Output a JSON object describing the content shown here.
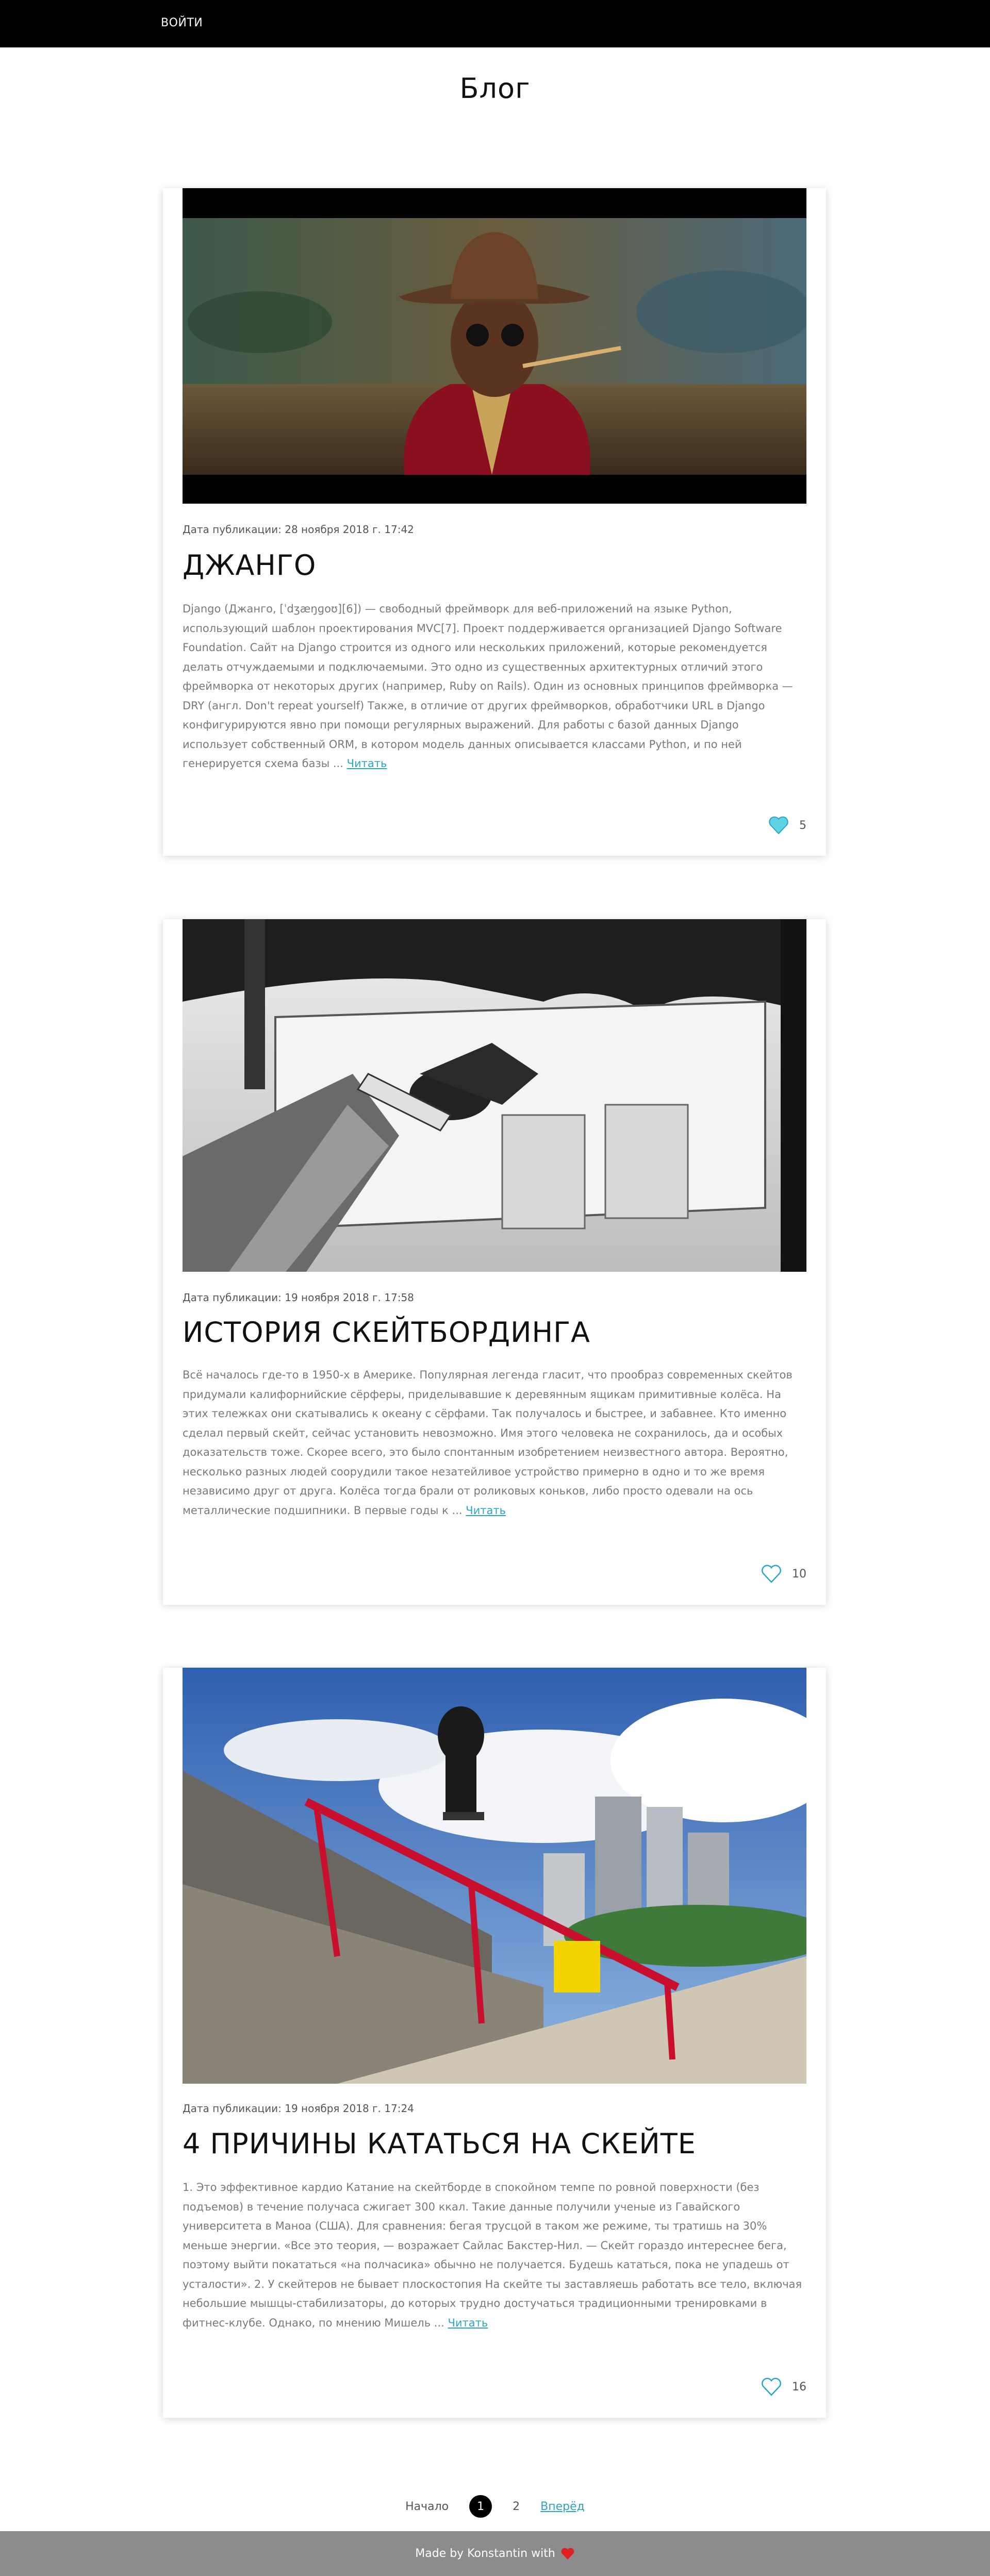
{
  "nav": {
    "login_label": "ВОЙТИ"
  },
  "page": {
    "title": "Блог"
  },
  "posts": [
    {
      "date": "Дата публикации: 28 ноября 2018 г. 17:42",
      "title": "ДЖАНГО",
      "excerpt": "Django (Джанго, [ˈdʒæŋɡoʊ][6]) — свободный фреймворк для веб-приложений на языке Python, использующий шаблон проектирования MVC[7]. Проект поддерживается организацией Django Software Foundation. Сайт на Django строится из одного или нескольких приложений, которые рекомендуется делать отчуждаемыми и подключаемыми. Это одно из существенных архитектурных отличий этого фреймворка от некоторых других (например, Ruby on Rails). Один из основных принципов фреймворка — DRY (англ. Don't repeat yourself) Также, в отличие от других фреймворков, обработчики URL в Django конфигурируются явно при помощи регулярных выражений. Для работы с базой данных Django использует собственный ORM, в котором модель данных описывается классами Python, и по ней генерируется схема базы ...",
      "read_label": "Читать",
      "likes": "5",
      "liked": true,
      "image_alt": "cowboy-portrait"
    },
    {
      "date": "Дата публикации: 19 ноября 2018 г. 17:58",
      "title": "ИСТОРИЯ СКЕЙТБОРДИНГА",
      "excerpt": "Всё началось где-то в 1950-х в Америке. Популярная легенда гласит, что прообраз современных скейтов придумали калифорнийские сёрферы, приделывавшие к деревянным ящикам примитивные колёса. На этих тележках они скатывались к океану с сёрфами. Так получалось и быстрее, и забавнее. Кто именно сделал первый скейт, сейчас установить невозможно. Имя этого человека не сохранилось, да и особых доказательств тоже. Скорее всего, это было спонтанным изобретением неизвестного автора. Вероятно, несколько разных людей соорудили такое незатейливое устройство примерно в одно и то же время независимо друг от друга. Колёса тогда брали от роликовых коньков, либо просто одевали на ось металлические подшипники. В первые годы к ...",
      "read_label": "Читать",
      "likes": "10",
      "liked": false,
      "image_alt": "skateboarder-bw"
    },
    {
      "date": "Дата публикации: 19 ноября 2018 г. 17:24",
      "title": "4 ПРИЧИНЫ КАТАТЬСЯ НА СКЕЙТЕ",
      "excerpt": "1. Это эффективное кардио Катание на скейтборде в спокойном темпе по ровной поверхности (без подъемов) в течение получаса сжигает 300 ккал. Такие данные получили ученые из Гавайского университета в Маноа (США). Для сравнения: бегая трусцой в таком же режиме, ты тратишь на 30% меньше энергии. «Все это теория, — возражает Сайлас Бакстер-Нил. — Скейт гораздо интереснее бега, поэтому выйти покататься «на полчасика» обычно не получается. Будешь кататься, пока не упадешь от усталости». 2. У скейтеров не бывает плоскостопия На скейте ты заставляешь работать все тело, включая небольшие мышцы-стабилизаторы, до которых трудно достучаться традиционными тренировками в фитнес-клубе. Однако, по мнению Мишель ...",
      "read_label": "Читать",
      "likes": "16",
      "liked": false,
      "image_alt": "skater-rail"
    }
  ],
  "pagination": {
    "first_label": "Начало",
    "current": "1",
    "page2": "2",
    "next_label": "Вперёд"
  },
  "footer": {
    "text": "Made by Konstantin with"
  },
  "colors": {
    "accent": "#2aa6c4",
    "heart_fill": "#5fd3e6",
    "heart_red": "#e02020",
    "footer_bg": "#8c8c8c"
  },
  "icons": {
    "like": "heart-icon",
    "footer": "heart-icon"
  }
}
